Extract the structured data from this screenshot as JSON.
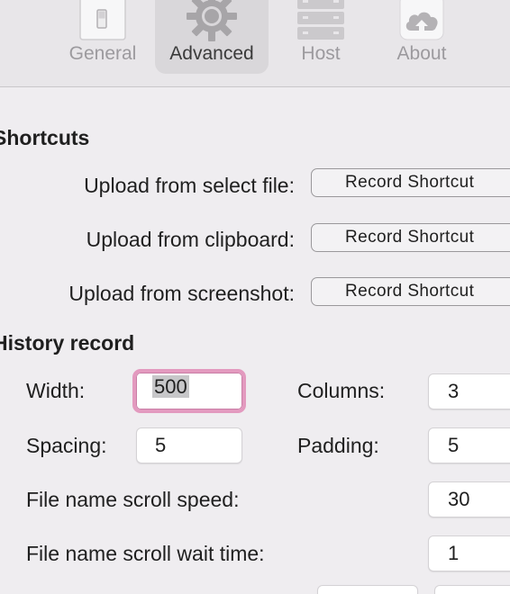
{
  "toolbar": {
    "tabs": [
      {
        "label": "General",
        "icon": "switch-icon",
        "active": false
      },
      {
        "label": "Advanced",
        "icon": "gear-icon",
        "active": true
      },
      {
        "label": "Host",
        "icon": "server-icon",
        "active": false
      },
      {
        "label": "About",
        "icon": "cloud-upload-icon",
        "active": false
      }
    ]
  },
  "shortcuts": {
    "title": "Shortcuts",
    "rows": [
      {
        "label": "Upload from select file:",
        "button": "Record Shortcut"
      },
      {
        "label": "Upload from clipboard:",
        "button": "Record Shortcut"
      },
      {
        "label": "Upload from screenshot:",
        "button": "Record Shortcut"
      }
    ]
  },
  "history": {
    "title": "History record",
    "width_label": "Width:",
    "width_value": "500",
    "columns_label": "Columns:",
    "columns_value": "3",
    "spacing_label": "Spacing:",
    "spacing_value": "5",
    "padding_label": "Padding:",
    "padding_value": "5",
    "scroll_speed_label": "File name scroll speed:",
    "scroll_speed_value": "30",
    "scroll_wait_label": "File name scroll wait time:",
    "scroll_wait_value": "1"
  },
  "colors": {
    "focus_ring": "#e39abf",
    "active_tab_bg": "#d9d7da",
    "background": "#efedf0"
  }
}
